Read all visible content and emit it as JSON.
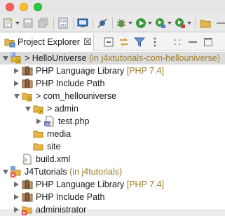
{
  "window": {
    "traffic_lights": [
      "close",
      "minimize",
      "maximize"
    ]
  },
  "toolbar": {
    "icons": [
      "new-icon",
      "save-icon",
      "save-all-icon",
      "binary-icon",
      "console-icon",
      "skip-breakpoints-icon",
      "debug-icon",
      "run-icon",
      "coverage-icon",
      "external-tools-icon",
      "open-folder-icon"
    ]
  },
  "view": {
    "tab_label": "Project Explorer",
    "close_glyph": "☒"
  },
  "tree": {
    "rows": [
      {
        "prefix": "> ",
        "label": "HelloUniverse",
        "decoration": " (in j4xtutorials-com-hellouniverse)",
        "selected": true
      },
      {
        "label": "PHP Language Library",
        "decoration": " [PHP 7.4]"
      },
      {
        "label": "PHP Include Path"
      },
      {
        "prefix": "> ",
        "label": "com_hellouniverse"
      },
      {
        "prefix": "> ",
        "label": "admin"
      },
      {
        "label": "test.php"
      },
      {
        "label": "media"
      },
      {
        "label": "site"
      },
      {
        "label": "build.xml"
      },
      {
        "label": "J4Tutorials",
        "decoration": " (in j4tutorials)"
      },
      {
        "label": "PHP Language Library",
        "decoration": " [PHP 7.4]"
      },
      {
        "label": "PHP Include Path"
      },
      {
        "label": "administrator"
      }
    ]
  },
  "colors": {
    "decoration": "#a07c2a",
    "selection": "#dcdcdc",
    "folder": "#e8b547"
  }
}
